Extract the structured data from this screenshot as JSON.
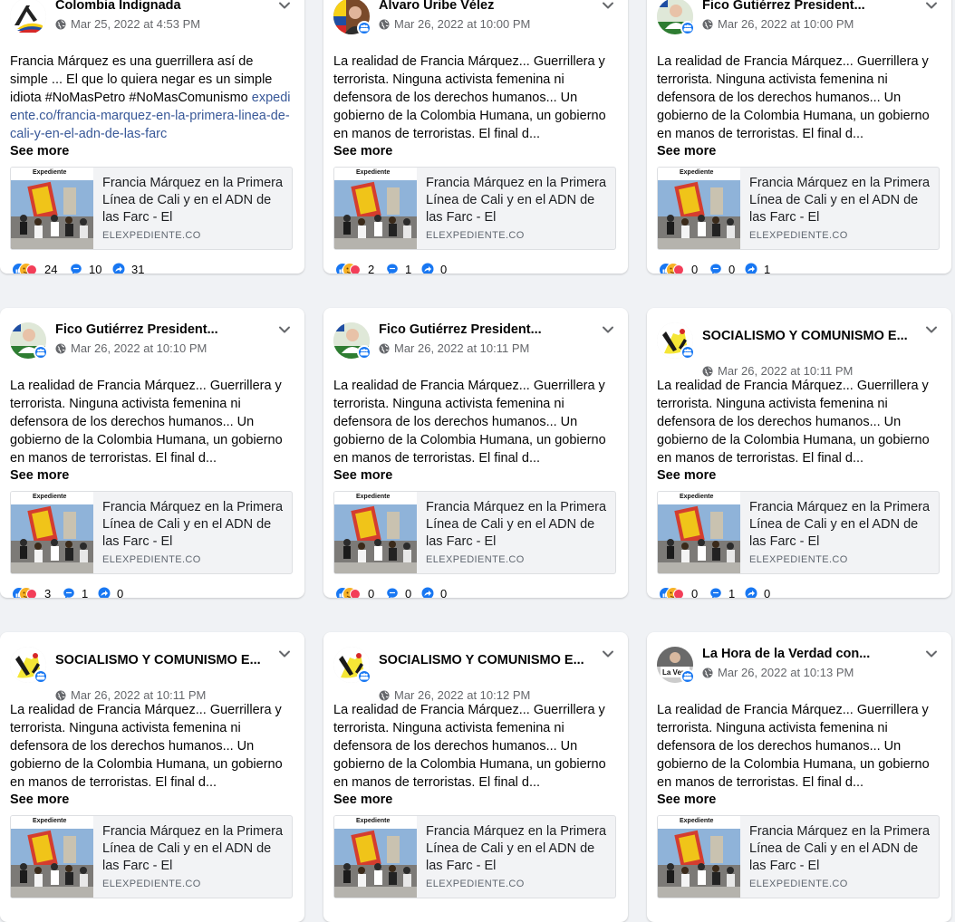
{
  "colors": {
    "accent": "#1877f2",
    "link": "#385898",
    "meta": "#65676b"
  },
  "posts": [
    {
      "author": "Colombia Indignada",
      "author_wrap": false,
      "avatar_icon": "colombia-indignada-logo-icon",
      "group_badge": false,
      "timestamp": "Mar 25, 2022 at 4:53 PM",
      "text": "Francia Márquez es una guerrillera así de simple ... El que lo quiera negar es un simple idiota #NoMasPetro #NoMasComunismo ",
      "link": "expediente.co/francia-marquez-en-la-primera-linea-de-cali-y-en-el-adn-de-las-farc",
      "see_more": "See more",
      "preview_title": "Francia Márquez en la Primera Línea de Cali y en el ADN de las Farc - El",
      "preview_domain": "ELEXPEDIENTE.CO",
      "thumb_label": "Expediente",
      "reactions": "24",
      "comments": "10",
      "shares": "31"
    },
    {
      "author": "Álvaro Uribe Vélez",
      "author_wrap": false,
      "avatar_icon": "alvaro-uribe-photo-icon",
      "group_badge": true,
      "timestamp": "Mar 26, 2022 at 10:00 PM",
      "text": "La realidad de Francia Márquez... Guerrillera y terrorista. Ninguna activista femenina ni defensora de los derechos humanos... Un gobierno de la Colombia Humana, un gobierno en manos de terroristas. El final d...",
      "link": "",
      "see_more": "See more",
      "preview_title": "Francia Márquez en la Primera Línea de Cali y en el ADN de las Farc - El",
      "preview_domain": "ELEXPEDIENTE.CO",
      "thumb_label": "Expediente",
      "reactions": "2",
      "comments": "1",
      "shares": "0"
    },
    {
      "author": "Fico Gutiérrez President...",
      "author_wrap": false,
      "avatar_icon": "fico-gutierrez-photo-icon",
      "group_badge": true,
      "timestamp": "Mar 26, 2022 at 10:00 PM",
      "text": "La realidad de Francia Márquez... Guerrillera y terrorista. Ninguna activista femenina ni defensora de los derechos humanos... Un gobierno de la Colombia Humana, un gobierno en manos de terroristas. El final d...",
      "link": "",
      "see_more": "See more",
      "preview_title": "Francia Márquez en la Primera Línea de Cali y en el ADN de las Farc - El",
      "preview_domain": "ELEXPEDIENTE.CO",
      "thumb_label": "Expediente",
      "reactions": "0",
      "comments": "0",
      "shares": "1"
    },
    {
      "author": "Fico Gutiérrez President...",
      "author_wrap": false,
      "avatar_icon": "fico-gutierrez-photo-icon",
      "group_badge": true,
      "timestamp": "Mar 26, 2022 at 10:10 PM",
      "text": "La realidad de Francia Márquez... Guerrillera y terrorista. Ninguna activista femenina ni defensora de los derechos humanos... Un gobierno de la Colombia Humana, un gobierno en manos de terroristas. El final d...",
      "link": "",
      "see_more": "See more",
      "preview_title": "Francia Márquez en la Primera Línea de Cali y en el ADN de las Farc - El",
      "preview_domain": "ELEXPEDIENTE.CO",
      "thumb_label": "Expediente",
      "reactions": "3",
      "comments": "1",
      "shares": "0"
    },
    {
      "author": "Fico Gutiérrez President...",
      "author_wrap": false,
      "avatar_icon": "fico-gutierrez-photo-icon",
      "group_badge": true,
      "timestamp": "Mar 26, 2022 at 10:11 PM",
      "text": "La realidad de Francia Márquez... Guerrillera y terrorista. Ninguna activista femenina ni defensora de los derechos humanos... Un gobierno de la Colombia Humana, un gobierno en manos de terroristas. El final d...",
      "link": "",
      "see_more": "See more",
      "preview_title": "Francia Márquez en la Primera Línea de Cali y en el ADN de las Farc - El",
      "preview_domain": "ELEXPEDIENTE.CO",
      "thumb_label": "Expediente",
      "reactions": "0",
      "comments": "0",
      "shares": "0"
    },
    {
      "author": "SOCIALISMO Y COMUNISMO E...",
      "author_wrap": true,
      "avatar_icon": "socialismo-comunismo-logo-icon",
      "group_badge": true,
      "timestamp": "Mar 26, 2022 at 10:11 PM",
      "text": "La realidad de Francia Márquez... Guerrillera y terrorista. Ninguna activista femenina ni defensora de los derechos humanos... Un gobierno de la Colombia Humana, un gobierno en manos de terroristas. El final d...",
      "link": "",
      "see_more": "See more",
      "preview_title": "Francia Márquez en la Primera Línea de Cali y en el ADN de las Farc - El",
      "preview_domain": "ELEXPEDIENTE.CO",
      "thumb_label": "Expediente",
      "reactions": "0",
      "comments": "1",
      "shares": "0"
    },
    {
      "author": "SOCIALISMO Y COMUNISMO E...",
      "author_wrap": true,
      "avatar_icon": "socialismo-comunismo-logo-icon",
      "group_badge": true,
      "timestamp": "Mar 26, 2022 at 10:11 PM",
      "text": "La realidad de Francia Márquez... Guerrillera y terrorista. Ninguna activista femenina ni defensora de los derechos humanos... Un gobierno de la Colombia Humana, un gobierno en manos de terroristas. El final d...",
      "link": "",
      "see_more": "See more",
      "preview_title": "Francia Márquez en la Primera Línea de Cali y en el ADN de las Farc - El",
      "preview_domain": "ELEXPEDIENTE.CO",
      "thumb_label": "Expediente",
      "reactions": "",
      "comments": "",
      "shares": ""
    },
    {
      "author": "SOCIALISMO Y COMUNISMO E...",
      "author_wrap": true,
      "avatar_icon": "socialismo-comunismo-logo-icon",
      "group_badge": true,
      "timestamp": "Mar 26, 2022 at 10:12 PM",
      "text": "La realidad de Francia Márquez... Guerrillera y terrorista. Ninguna activista femenina ni defensora de los derechos humanos... Un gobierno de la Colombia Humana, un gobierno en manos de terroristas. El final d...",
      "link": "",
      "see_more": "See more",
      "preview_title": "Francia Márquez en la Primera Línea de Cali y en el ADN de las Farc - El",
      "preview_domain": "ELEXPEDIENTE.CO",
      "thumb_label": "Expediente",
      "reactions": "",
      "comments": "",
      "shares": ""
    },
    {
      "author": "La Hora de la Verdad con...",
      "author_wrap": false,
      "avatar_icon": "la-hora-de-la-verdad-logo-icon",
      "avatar_text": "La Verdad",
      "group_badge": true,
      "timestamp": "Mar 26, 2022 at 10:13 PM",
      "text": "La realidad de Francia Márquez... Guerrillera y terrorista. Ninguna activista femenina ni defensora de los derechos humanos... Un gobierno de la Colombia Humana, un gobierno en manos de terroristas. El final d...",
      "link": "",
      "see_more": "See more",
      "preview_title": "Francia Márquez en la Primera Línea de Cali y en el ADN de las Farc - El",
      "preview_domain": "ELEXPEDIENTE.CO",
      "thumb_label": "Expediente",
      "reactions": "",
      "comments": "",
      "shares": ""
    }
  ]
}
